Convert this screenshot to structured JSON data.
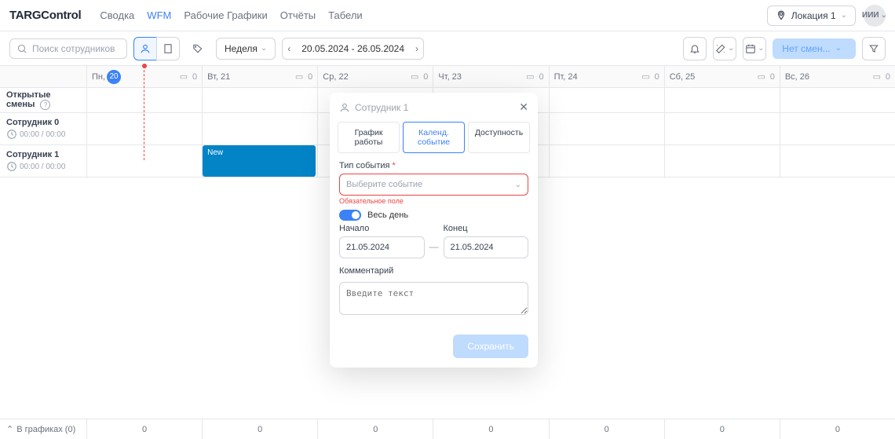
{
  "header": {
    "logo": "TARGControl",
    "nav": [
      "Сводка",
      "WFM",
      "Рабочие Графики",
      "Отчёты",
      "Табели"
    ],
    "nav_active_index": 1,
    "location_label": "Локация 1",
    "avatar_initials": "ИИИ"
  },
  "toolbar": {
    "search_placeholder": "Поиск сотрудников",
    "period_label": "Неделя",
    "date_range": "20.05.2024 - 26.05.2024",
    "no_shifts_label": "Нет смен..."
  },
  "days": [
    {
      "label": "Пн,",
      "num": "20",
      "today": true,
      "count": "0"
    },
    {
      "label": "Вт, 21",
      "today": false,
      "count": "0"
    },
    {
      "label": "Ср, 22",
      "today": false,
      "count": "0"
    },
    {
      "label": "Чт, 23",
      "today": false,
      "count": "0"
    },
    {
      "label": "Пт, 24",
      "today": false,
      "count": "0"
    },
    {
      "label": "Сб, 25",
      "today": false,
      "count": "0"
    },
    {
      "label": "Вс, 26",
      "today": false,
      "count": "0"
    }
  ],
  "rows": {
    "open_shifts": "Открытые смены",
    "employees": [
      {
        "name": "Сотрудник 0",
        "time": "00:00 / 00:00"
      },
      {
        "name": "Сотрудник 1",
        "time": "00:00 / 00:00"
      }
    ]
  },
  "shift": {
    "label": "New"
  },
  "modal": {
    "title": "Сотрудник 1",
    "tabs": [
      "График работы",
      "Календ. событие",
      "Доступность"
    ],
    "active_tab_index": 1,
    "event_type_label": "Тип события",
    "event_type_placeholder": "Выберите событие",
    "required_text": "Обязательное поле",
    "all_day_label": "Весь день",
    "start_label": "Начало",
    "end_label": "Конец",
    "start_value": "21.05.2024",
    "end_value": "21.05.2024",
    "comment_label": "Комментарий",
    "comment_placeholder": "Введите текст",
    "save_label": "Сохранить"
  },
  "footer": {
    "label": "В графиках (0)",
    "values": [
      "0",
      "0",
      "0",
      "0",
      "0",
      "0",
      "0"
    ]
  }
}
